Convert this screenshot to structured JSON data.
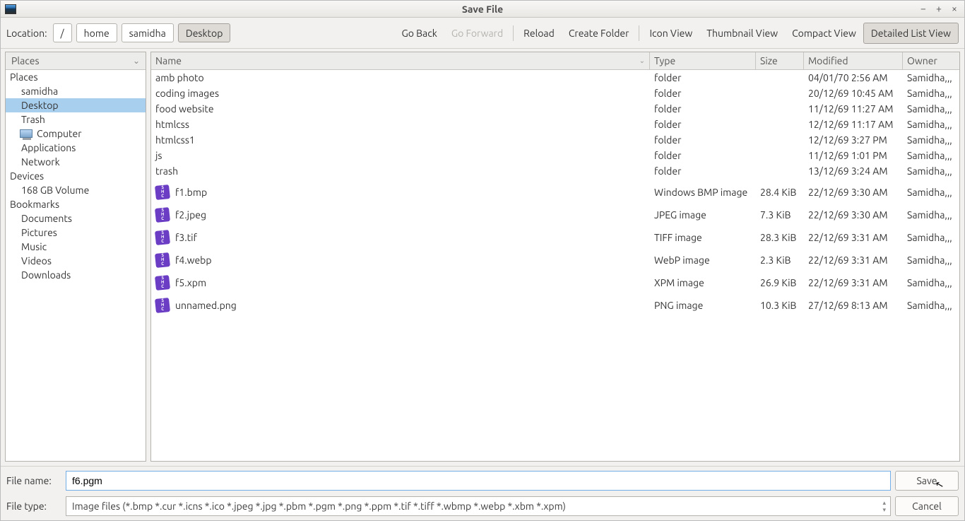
{
  "window": {
    "title": "Save File"
  },
  "toolbar": {
    "location_label": "Location:",
    "path": [
      "/",
      "home",
      "samidha",
      "Desktop"
    ],
    "active_path_index": 3,
    "nav": {
      "go_back": "Go Back",
      "go_forward": "Go Forward",
      "reload": "Reload",
      "create_folder": "Create Folder"
    },
    "views": {
      "icon": "Icon View",
      "thumbnail": "Thumbnail View",
      "compact": "Compact View",
      "detailed": "Detailed List View",
      "active": "detailed"
    }
  },
  "sidebar": {
    "header": "Places",
    "sections": [
      {
        "label": "Places",
        "items": [
          {
            "label": "samidha"
          },
          {
            "label": "Desktop",
            "selected": true
          },
          {
            "label": "Trash"
          },
          {
            "label": "Computer",
            "computer": true
          },
          {
            "label": "Applications"
          },
          {
            "label": "Network"
          }
        ]
      },
      {
        "label": "Devices",
        "items": [
          {
            "label": "168 GB Volume"
          }
        ]
      },
      {
        "label": "Bookmarks",
        "items": [
          {
            "label": "Documents"
          },
          {
            "label": "Pictures"
          },
          {
            "label": "Music"
          },
          {
            "label": "Videos"
          },
          {
            "label": "Downloads"
          }
        ]
      }
    ]
  },
  "filelist": {
    "columns": {
      "name": "Name",
      "type": "Type",
      "size": "Size",
      "modified": "Modified",
      "owner": "Owner"
    },
    "rows": [
      {
        "name": "amb photo",
        "type": "folder",
        "size": "",
        "modified": "04/01/70 2:56 AM",
        "owner": "Samidha,,,",
        "icon": false,
        "gap": false
      },
      {
        "name": "coding images",
        "type": "folder",
        "size": "",
        "modified": "20/12/69 10:45 AM",
        "owner": "Samidha,,,",
        "icon": false,
        "gap": false
      },
      {
        "name": "food website",
        "type": "folder",
        "size": "",
        "modified": "11/12/69 11:27 AM",
        "owner": "Samidha,,,",
        "icon": false,
        "gap": false
      },
      {
        "name": "htmlcss",
        "type": "folder",
        "size": "",
        "modified": "12/12/69 11:17 AM",
        "owner": "Samidha,,,",
        "icon": false,
        "gap": false
      },
      {
        "name": "htmlcss1",
        "type": "folder",
        "size": "",
        "modified": "12/12/69 3:27 PM",
        "owner": "Samidha,,,",
        "icon": false,
        "gap": false
      },
      {
        "name": "js",
        "type": "folder",
        "size": "",
        "modified": "11/12/69 1:01 PM",
        "owner": "Samidha,,,",
        "icon": false,
        "gap": false
      },
      {
        "name": "trash",
        "type": "folder",
        "size": "",
        "modified": "13/12/69 3:24 AM",
        "owner": "Samidha,,,",
        "icon": false,
        "gap": true
      },
      {
        "name": "f1.bmp",
        "type": "Windows BMP image",
        "size": "28.4 KiB",
        "modified": "22/12/69 3:30 AM",
        "owner": "Samidha,,,",
        "icon": true,
        "gap": true
      },
      {
        "name": "f2.jpeg",
        "type": "JPEG image",
        "size": "7.3 KiB",
        "modified": "22/12/69 3:30 AM",
        "owner": "Samidha,,,",
        "icon": true,
        "gap": true
      },
      {
        "name": "f3.tif",
        "type": "TIFF image",
        "size": "28.3 KiB",
        "modified": "22/12/69 3:31 AM",
        "owner": "Samidha,,,",
        "icon": true,
        "gap": true
      },
      {
        "name": "f4.webp",
        "type": "WebP image",
        "size": "2.3 KiB",
        "modified": "22/12/69 3:31 AM",
        "owner": "Samidha,,,",
        "icon": true,
        "gap": true
      },
      {
        "name": "f5.xpm",
        "type": "XPM image",
        "size": "26.9 KiB",
        "modified": "22/12/69 3:31 AM",
        "owner": "Samidha,,,",
        "icon": true,
        "gap": true
      },
      {
        "name": "unnamed.png",
        "type": "PNG image",
        "size": "10.3 KiB",
        "modified": "27/12/69 8:13 AM",
        "owner": "Samidha,,,",
        "icon": true,
        "gap": false
      }
    ]
  },
  "bottom": {
    "filename_label": "File name:",
    "filename_value": "f6.pgm",
    "filetype_label": "File type:",
    "filetype_value": "Image files (*.bmp *.cur *.icns *.ico *.jpeg *.jpg *.pbm *.pgm *.png *.ppm *.tif *.tiff *.wbmp *.webp *.xbm *.xpm)",
    "save_label": "Save",
    "cancel_label": "Cancel"
  }
}
